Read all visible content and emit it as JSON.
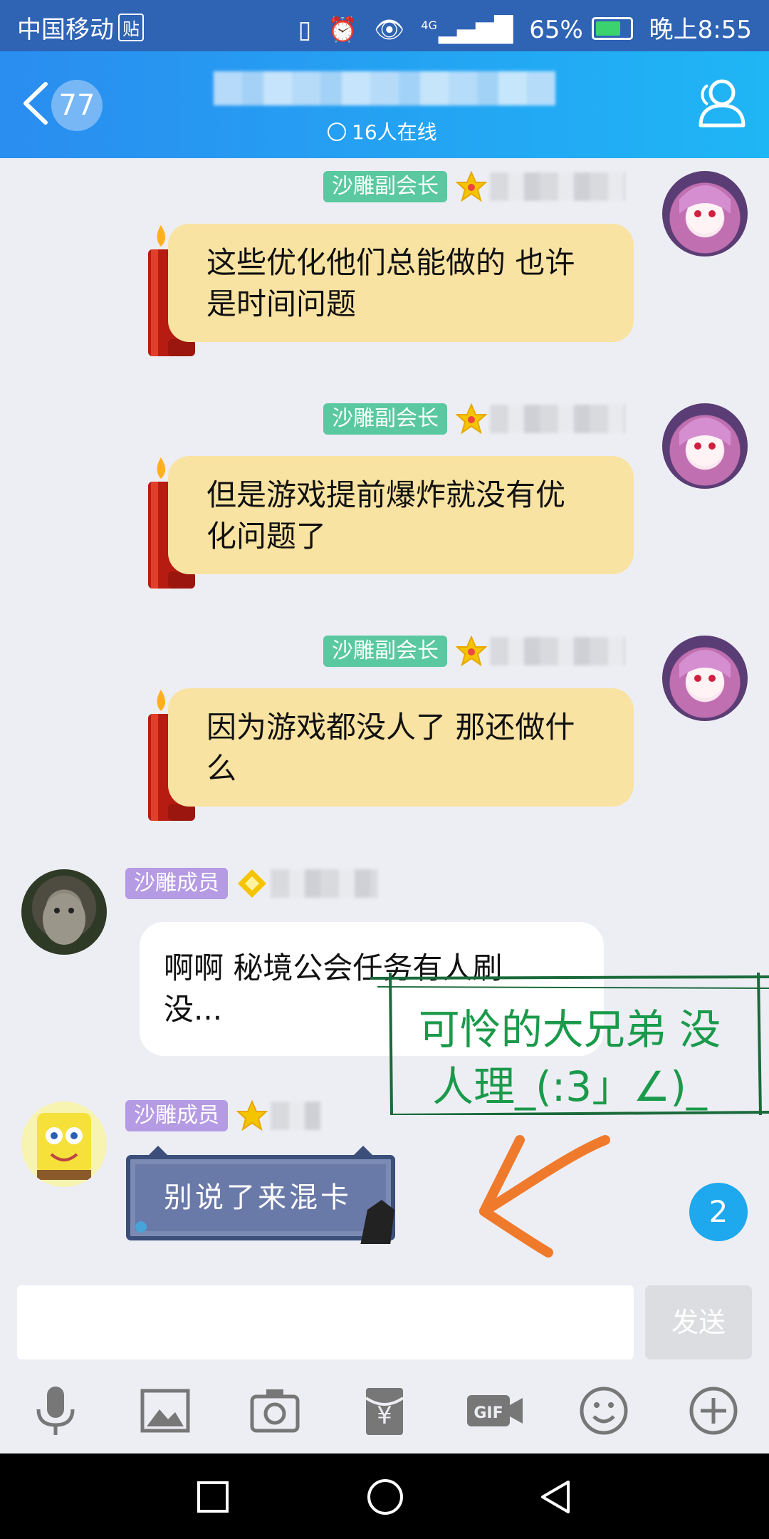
{
  "status_bar": {
    "carrier": "中国移动",
    "carrier_tag": "贴",
    "network": "4G",
    "battery": "65%",
    "time": "晚上8:55"
  },
  "header": {
    "unread_count": "77",
    "online_text": "16人在线"
  },
  "messages": [
    {
      "role_badge": "沙雕副会长",
      "role_color": "#5ac8a0",
      "text_line1": "这些优化他们总能做的 也许",
      "text_line2": "是时间问题"
    },
    {
      "role_badge": "沙雕副会长",
      "role_color": "#5ac8a0",
      "text_line1": "但是游戏提前爆炸就没有优",
      "text_line2": "化问题了"
    },
    {
      "role_badge": "沙雕副会长",
      "role_color": "#5ac8a0",
      "text_line1": "因为游戏都没人了 那还做什",
      "text_line2": "么"
    },
    {
      "role_badge": "沙雕成员",
      "role_color": "#b59be3",
      "text_line1": "啊啊 秘境公会任务有人刷",
      "text_line2": "没..."
    },
    {
      "role_badge": "沙雕成员",
      "role_color": "#b59be3",
      "sticker_text": "别说了来混卡"
    }
  ],
  "annotation": {
    "text_line1": "可怜的大兄弟 没",
    "text_line2": "人理_(:3」∠)_",
    "color": "#1a9a4a",
    "arrow_color": "#f07a2c"
  },
  "new_message_badge": "2",
  "input_bar": {
    "placeholder": "",
    "send_label": "发送"
  },
  "toolbar_icons": [
    "microphone-icon",
    "image-icon",
    "camera-icon",
    "red-packet-icon",
    "gif-icon",
    "emoji-icon",
    "plus-icon"
  ]
}
